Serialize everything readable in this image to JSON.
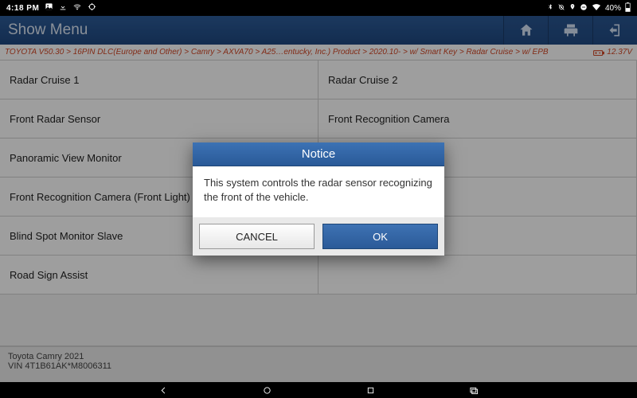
{
  "status": {
    "time": "4:18 PM",
    "battery_pct": "40%"
  },
  "titlebar": {
    "title": "Show Menu"
  },
  "breadcrumb": {
    "path": "TOYOTA V50.30 > 16PIN DLC(Europe and Other) > Camry > AXVA70 > A25…entucky, Inc.) Product > 2020.10- > w/ Smart Key > Radar Cruise > w/ EPB",
    "voltage": "12.37V"
  },
  "menu": {
    "items": [
      "Radar Cruise 1",
      "Radar Cruise 2",
      "Front Radar Sensor",
      "Front Recognition Camera",
      "Panoramic View Monitor",
      "",
      "Front Recognition Camera (Front Light)",
      "",
      "Blind Spot Monitor Slave",
      "",
      "Road Sign Assist",
      ""
    ]
  },
  "footer": {
    "line1": "Toyota Camry 2021",
    "line2": "VIN 4T1B61AK*M8006311"
  },
  "dialog": {
    "title": "Notice",
    "message": "This system controls the radar sensor recognizing the front of the vehicle.",
    "cancel": "CANCEL",
    "ok": "OK"
  }
}
